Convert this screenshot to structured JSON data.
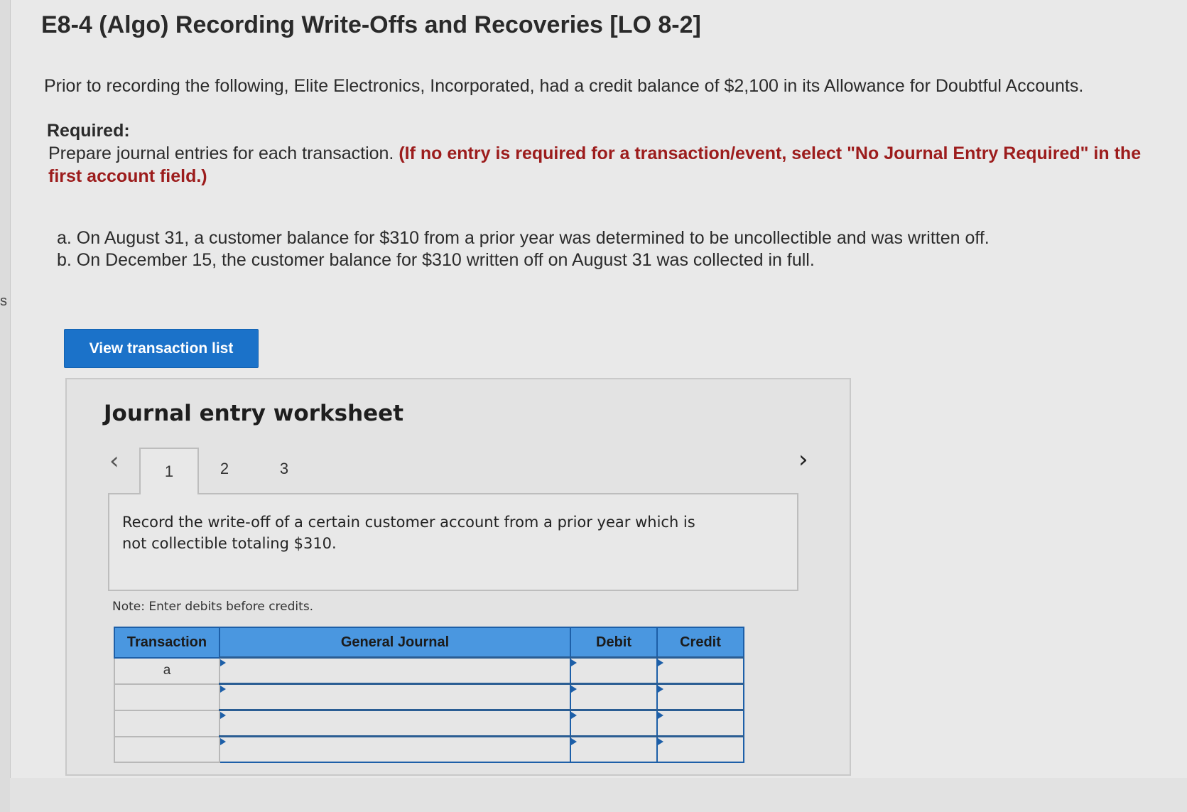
{
  "left_edge_fragment": "s",
  "title": "E8-4 (Algo) Recording Write-Offs and Recoveries [LO 8-2]",
  "intro": "Prior to recording the following, Elite Electronics, Incorporated, had a credit balance of $2,100 in its Allowance for Doubtful Accounts.",
  "required": {
    "heading": "Required:",
    "text": "Prepare journal entries for each transaction.",
    "emphasis": "(If no entry is required for a transaction/event, select \"No Journal Entry Required\" in the first account field.)"
  },
  "items": [
    "a. On August 31, a customer balance for $310 from a prior year was determined to be uncollectible and was written off.",
    "b. On December 15, the customer balance for $310 written off on August 31 was collected in full."
  ],
  "view_button_label": "View transaction list",
  "worksheet": {
    "title": "Journal entry worksheet",
    "prev_icon": "‹",
    "next_icon": "›",
    "tabs": [
      {
        "label": "1"
      },
      {
        "label": "2"
      },
      {
        "label": "3"
      }
    ],
    "active_tab": "1",
    "prompt": "Record the write-off of a certain customer account from a prior year which is not collectible totaling $310.",
    "note": "Note: Enter debits before credits.",
    "table": {
      "headers": [
        "Transaction",
        "General Journal",
        "Debit",
        "Credit"
      ],
      "rows": [
        {
          "transaction": "a",
          "account": "",
          "debit": "",
          "credit": ""
        },
        {
          "transaction": "",
          "account": "",
          "debit": "",
          "credit": ""
        },
        {
          "transaction": "",
          "account": "",
          "debit": "",
          "credit": ""
        },
        {
          "transaction": "",
          "account": "",
          "debit": "",
          "credit": ""
        }
      ]
    }
  },
  "colors": {
    "button_blue": "#1b72c9",
    "header_blue": "#4a97e0",
    "emphasis_red": "#9c1c1c"
  }
}
